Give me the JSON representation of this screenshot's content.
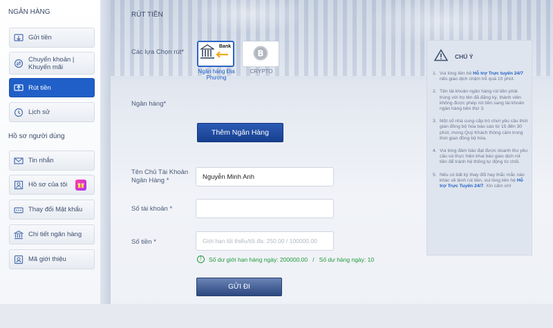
{
  "sidebar": {
    "bank_heading": "NGÂN HÀNG",
    "profile_heading": "Hồ sơ người dùng",
    "bank_items": [
      {
        "label": "Gửi tiền",
        "icon": "deposit-icon"
      },
      {
        "label": "Chuyển khoản | Khuyến mãi",
        "icon": "transfer-icon"
      },
      {
        "label": "Rút tiền",
        "icon": "withdraw-icon",
        "active": true
      },
      {
        "label": "Lịch sử",
        "icon": "history-icon"
      }
    ],
    "profile_items": [
      {
        "label": "Tin nhắn",
        "icon": "mail-icon"
      },
      {
        "label": "Hồ sơ của tôi",
        "icon": "profile-icon"
      },
      {
        "label": "Thay đổi Mật khẩu",
        "icon": "password-icon"
      },
      {
        "label": "Chi tiết ngân hàng",
        "icon": "bank-detail-icon"
      },
      {
        "label": "Mã giới thiệu",
        "icon": "referral-icon"
      }
    ]
  },
  "main": {
    "title": "RÚT TIỀN",
    "options_label": "Các lựa Chọn rút*",
    "options": [
      {
        "label": "Ngân hàng Địa Phương",
        "badge": "Bank",
        "selected": true
      },
      {
        "label": "CRYPTO",
        "selected": false
      }
    ],
    "bank_label": "Ngân hàng*",
    "add_bank_button": "Thêm Ngân Hàng",
    "account_name_label": "Tên Chủ Tài Khoản Ngân Hàng *",
    "account_name_value": "Nguyễn Minh Anh",
    "account_number_label": "Số tài khoản *",
    "account_number_value": "",
    "amount_label": "Số tiền  *",
    "amount_placeholder": "Giới hạn tối thiểu/tối đa: 250.00 / 100000.00",
    "balance_text": "Số dư giới hạn hàng ngày: 200000.00   /   Số dư hàng ngày: 10",
    "submit_button": "GỬI ĐI"
  },
  "note": {
    "title": "CHÚ Ý",
    "items": [
      {
        "num": "1.",
        "pre": "Vui lòng liên hệ ",
        "link": "Hỗ trợ Trực tuyến 24/7",
        "post": " nếu giao dịch chậm trễ quá 10 phút."
      },
      {
        "num": "2.",
        "pre": "Tên tài khoản ngân hàng rút tiền phải trùng với họ tên đã đăng ký, thành viên không được phép rút tiền sang tài khoản ngân hàng bên thứ 3.",
        "link": "",
        "post": ""
      },
      {
        "num": "3.",
        "pre": "Một số nhà cung cấp trò chơi yêu cầu thời gian đồng bộ hóa báo cáo từ 15 đến 30 phút, mong Quý Khách thông cảm trong thời gian đồng bộ hóa.",
        "link": "",
        "post": ""
      },
      {
        "num": "4.",
        "pre": "Vui lòng đảm bảo đạt được doanh thu yêu cầu và thực hiện khai báo giao dịch rút tiền để tránh hệ thống tự động từ chối.",
        "link": "",
        "post": ""
      },
      {
        "num": "5.",
        "pre": "Nếu có bất kỳ thay đổi hay thắc mắc nào khác về lệnh rút tiền, vui lòng liên hệ ",
        "link": "Hỗ trợ Trực Tuyến 24/7",
        "post": ". Xin cảm ơn!"
      }
    ]
  },
  "colors": {
    "accent": "#1f5fc7",
    "button_dark": "#173f8f",
    "success": "#1e9a3a"
  }
}
